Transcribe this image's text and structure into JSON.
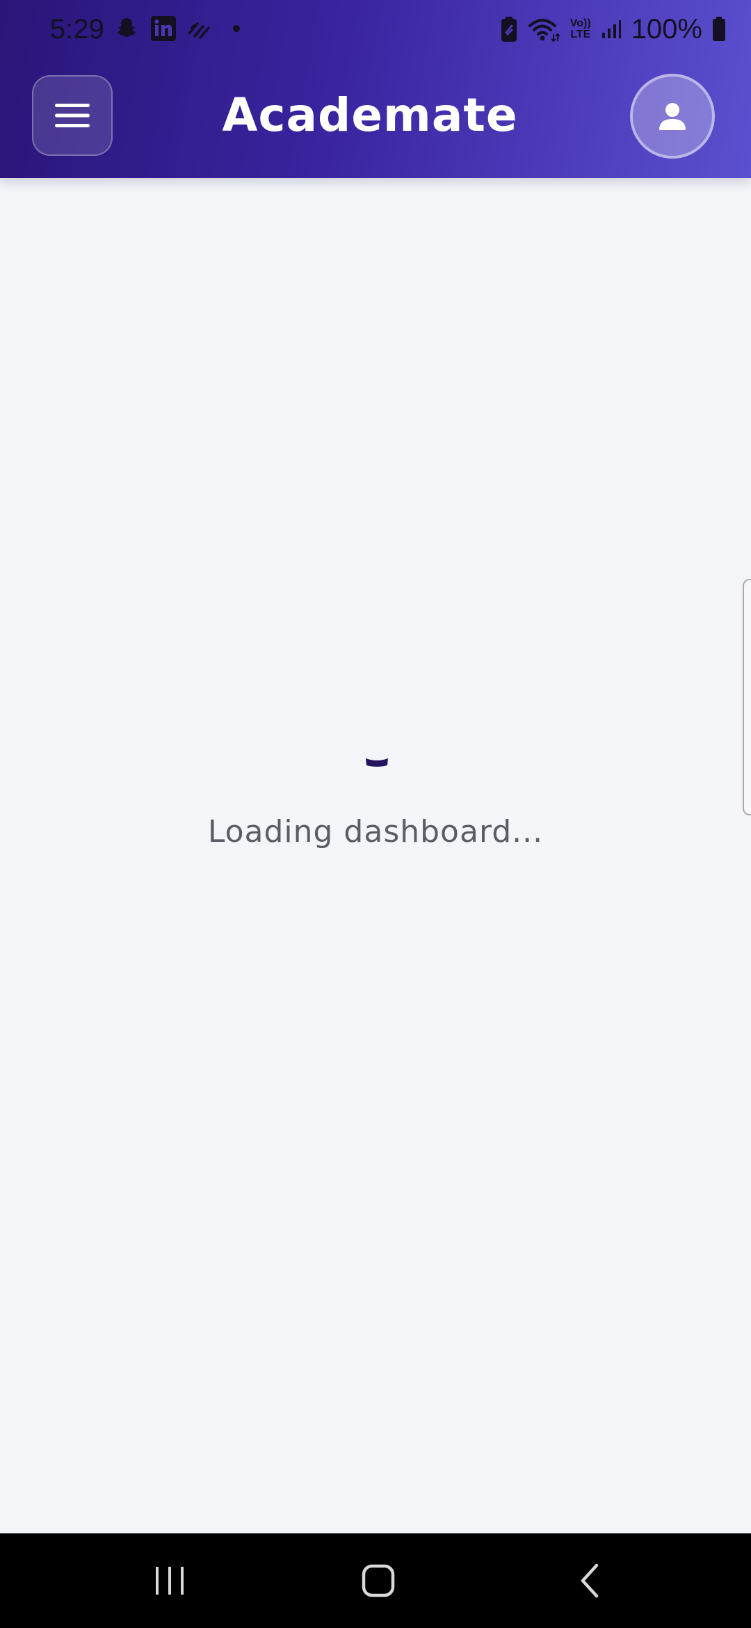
{
  "status_bar": {
    "time": "5:29",
    "battery": "100%",
    "icons_left": [
      "snapchat-icon",
      "linkedin-icon",
      "activity-icon",
      "dot-icon"
    ],
    "icons_right": [
      "battery-saver-icon",
      "wifi-icon",
      "volte-icon",
      "signal-icon",
      "battery-icon"
    ],
    "volte_label_top": "Vo))",
    "volte_label_bottom": "LTE"
  },
  "header": {
    "title": "Academate",
    "gradient_start": "#2b1578",
    "gradient_end": "#5b50cf"
  },
  "main": {
    "loading_text": "Loading dashboard...",
    "spinner_color": "#24135f"
  },
  "nav_bar": {
    "buttons": [
      "recent-apps",
      "home",
      "back"
    ]
  }
}
